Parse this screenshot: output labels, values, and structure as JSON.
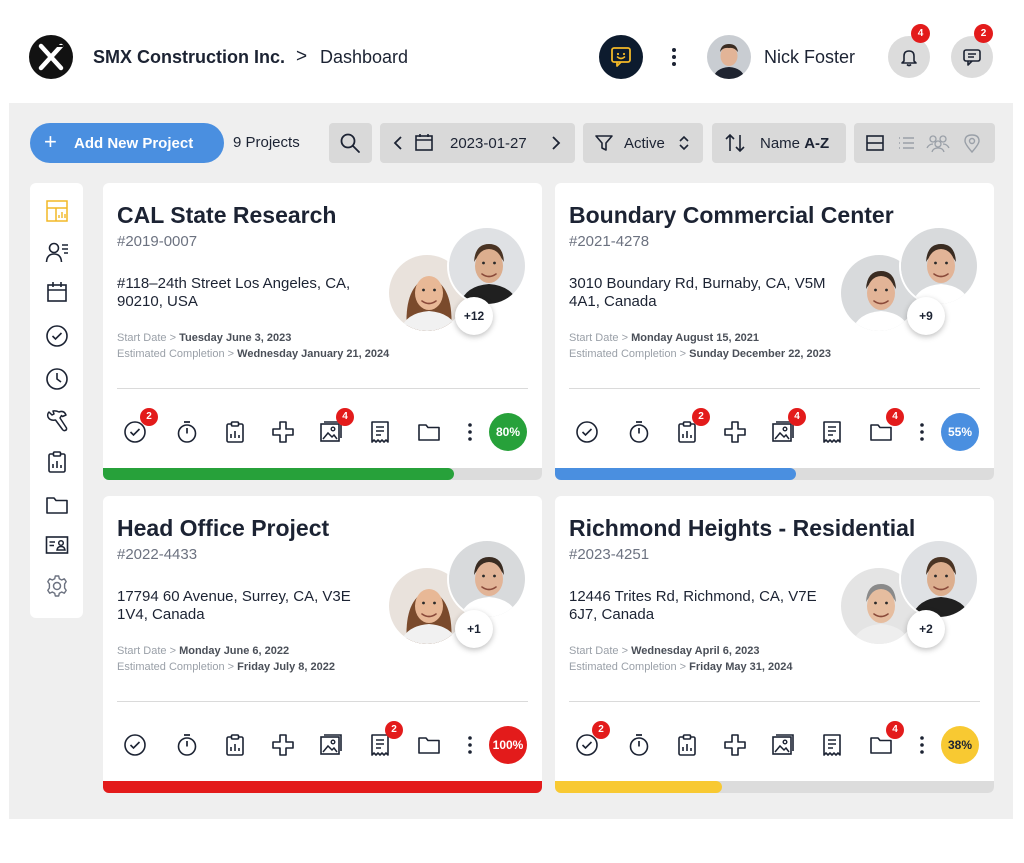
{
  "header": {
    "company": "SMX Construction Inc.",
    "separator": ">",
    "page": "Dashboard",
    "user_name": "Nick Foster",
    "notifications_count": "4",
    "messages_count": "2"
  },
  "toolbar": {
    "add_label": "Add New Project",
    "add_icon": "+",
    "project_count": "9 Projects",
    "date": "2023-01-27",
    "status_filter": "Active",
    "sort_prefix": "Name",
    "sort_value": "A-Z"
  },
  "sidebar": {
    "items": [
      "dashboard-icon",
      "contacts-icon",
      "calendar-icon",
      "tasks-icon",
      "time-icon",
      "tools-icon",
      "clipboard-icon",
      "folder-icon",
      "id-card-icon",
      "settings-icon"
    ],
    "active_color": "#f2b827"
  },
  "projects": [
    {
      "title": "CAL State Research",
      "code": "#2019-0007",
      "address": "#118–24th Street Los Angeles, CA, 90210, USA",
      "start_label": "Start Date >",
      "start_date": "Tuesday June 3, 2023",
      "completion_label": "Estimated Completion >",
      "completion_date": "Wednesday January 21, 2024",
      "team_more": "+12",
      "badges": {
        "tasks": "2",
        "photos": "4"
      },
      "progress": 0.8,
      "progress_label": "80%",
      "color": "#27a13a"
    },
    {
      "title": "Boundary Commercial Center",
      "code": "#2021-4278",
      "address": "3010 Boundary Rd, Burnaby, CA, V5M 4A1, Canada",
      "start_label": "Start Date >",
      "start_date": "Monday August 15, 2021",
      "completion_label": "Estimated Completion >",
      "completion_date": "Sunday December 22, 2023",
      "team_more": "+9",
      "badges": {
        "clipboard": "2",
        "photos": "4",
        "folder": "4"
      },
      "progress": 0.55,
      "progress_label": "55%",
      "color": "#4a8fe0"
    },
    {
      "title": "Head Office Project",
      "code": "#2022-4433",
      "address": "17794 60 Avenue, Surrey, CA, V3E 1V4, Canada",
      "start_label": "Start Date >",
      "start_date": "Monday June 6, 2022",
      "completion_label": "Estimated Completion >",
      "completion_date": "Friday July 8, 2022",
      "team_more": "+1",
      "badges": {
        "receipt": "2"
      },
      "progress": 1.0,
      "progress_label": "100%",
      "color": "#e31b1b"
    },
    {
      "title": "Richmond Heights - Residential",
      "code": "#2023-4251",
      "address": "12446 Trites Rd, Richmond, CA, V7E 6J7, Canada",
      "start_label": "Start Date >",
      "start_date": "Wednesday April 6, 2023",
      "completion_label": "Estimated Completion >",
      "completion_date": "Friday May 31, 2024",
      "team_more": "+2",
      "badges": {
        "tasks": "2",
        "folder": "4"
      },
      "progress": 0.38,
      "progress_label": "38%",
      "color": "#f8c932"
    }
  ]
}
